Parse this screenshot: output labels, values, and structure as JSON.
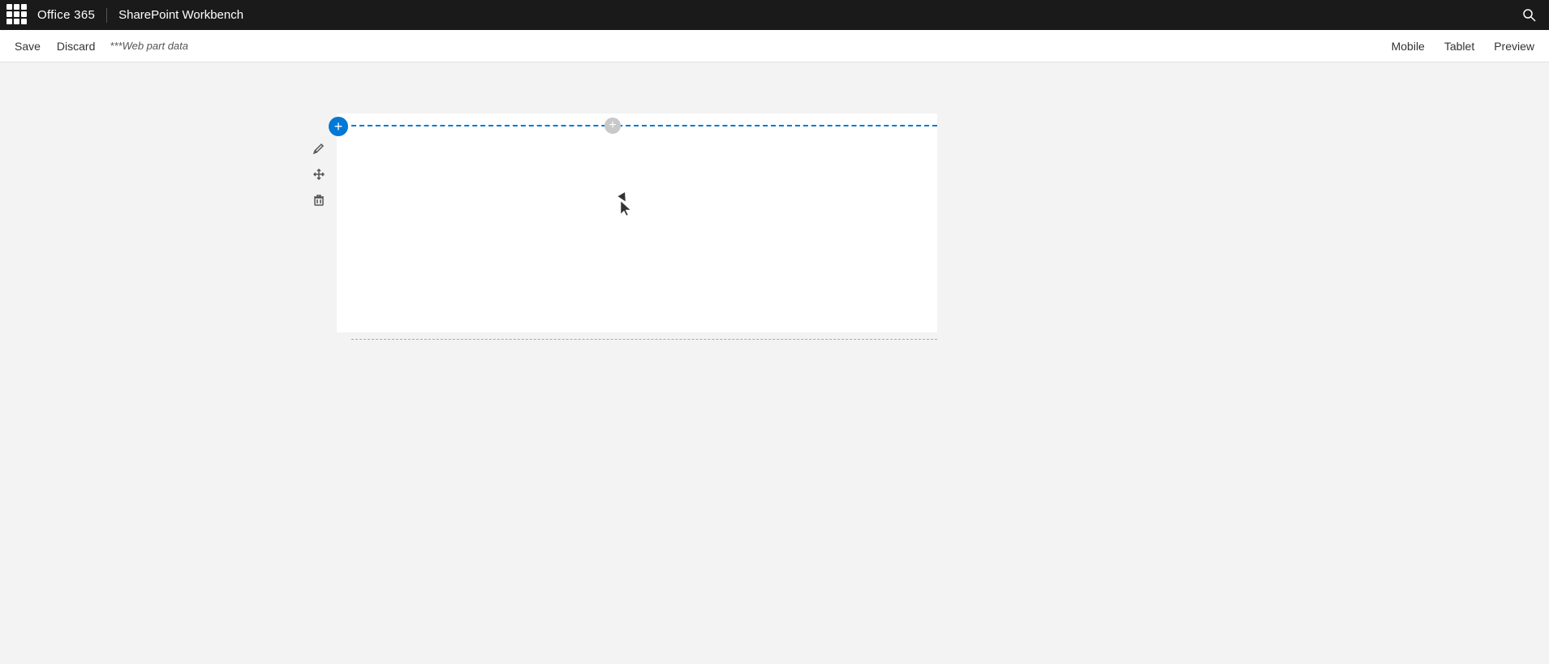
{
  "topnav": {
    "app_name": "Office 365",
    "separator": "|",
    "workbench_title": "SharePoint Workbench"
  },
  "toolbar": {
    "save_label": "Save",
    "discard_label": "Discard",
    "webpart_info": "***Web part data",
    "mobile_label": "Mobile",
    "tablet_label": "Tablet",
    "preview_label": "Preview"
  },
  "canvas": {
    "add_button_icon": "+",
    "center_add_icon": "+",
    "side_icons": {
      "edit": "✎",
      "move": "⊹",
      "delete": "🗑"
    }
  }
}
